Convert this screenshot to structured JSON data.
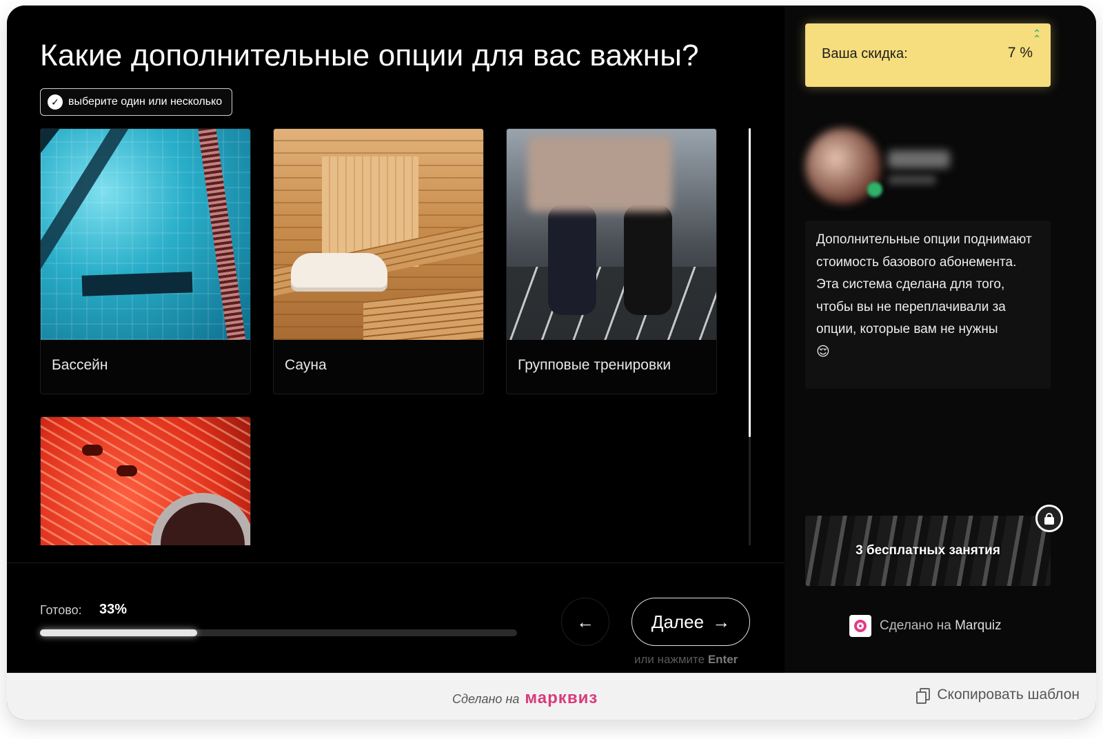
{
  "question": {
    "title": "Какие дополнительные опции для вас важны?",
    "hint": "выберите один или несколько"
  },
  "options": [
    {
      "label": "Бассейн"
    },
    {
      "label": "Сауна"
    },
    {
      "label": "Групповые тренировки"
    },
    {
      "label": ""
    }
  ],
  "progress": {
    "label": "Готово:",
    "value_text": "33%",
    "percent": 33
  },
  "navigation": {
    "back_icon": "←",
    "next_label": "Далее",
    "next_icon": "→",
    "enter_hint_prefix": "или нажмите",
    "enter_key": "Enter"
  },
  "sidebar": {
    "discount_label": "Ваша скидка:",
    "discount_value": "7 %",
    "discount_trend_icon": "double-chevron-up-icon",
    "message": "Дополнительные опции поднимают стоимость базового абонемента. Эта система сделана для того, чтобы вы не переплачивали за опции, которые вам не нужны",
    "message_emoji": "😌",
    "bonus_text": "3 бесплатных занятия",
    "made_with_prefix": "Сделано на",
    "made_with_brand": "Marquiz"
  },
  "bottom_bar": {
    "made_on_prefix": "Сделано на",
    "brand": "марквиз",
    "copy_label": "Скопировать шаблон"
  },
  "colors": {
    "accent_discount": "#f6dd7d",
    "brand_pink": "#d83b7c",
    "online_green": "#2fb36b"
  }
}
